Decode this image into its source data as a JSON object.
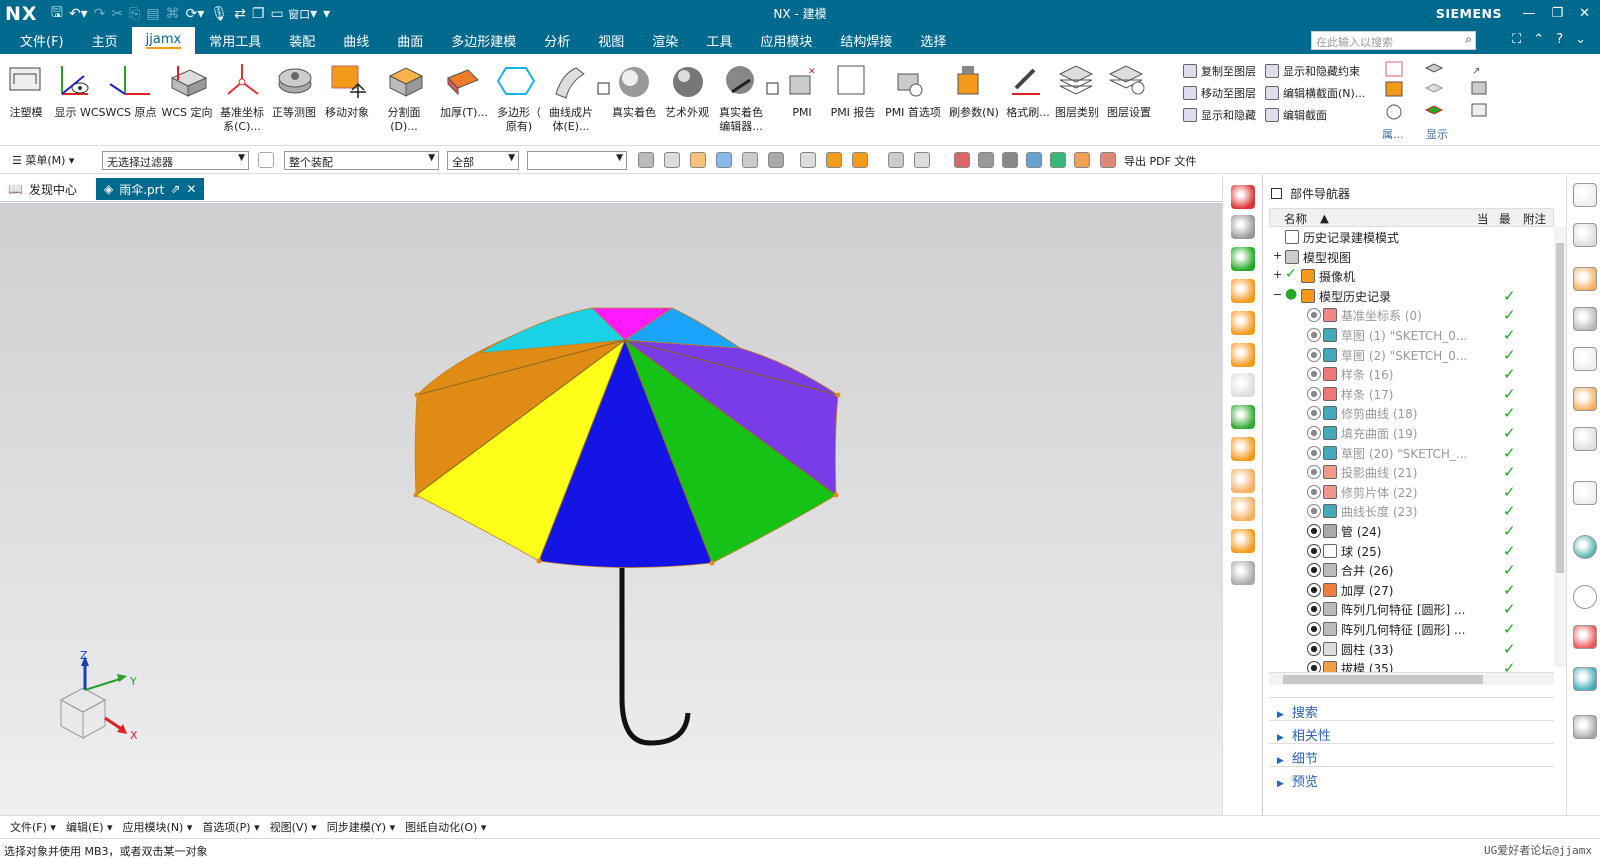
{
  "titlebar": {
    "logo": "NX",
    "title": "NX - 建模",
    "brand": "SIEMENS",
    "window_menu": "窗口"
  },
  "menubar": {
    "items": [
      "文件(F)",
      "主页",
      "jjamx",
      "常用工具",
      "装配",
      "曲线",
      "曲面",
      "多边形建模",
      "分析",
      "视图",
      "渲染",
      "工具",
      "应用模块",
      "结构焊接",
      "选择"
    ],
    "active": "jjamx",
    "search_placeholder": "在此输入以搜索"
  },
  "ribbon": {
    "buttons": [
      "注塑模",
      "显示 WCS",
      "WCS 原点",
      "WCS 定向",
      "基准坐标\n系(C)...",
      "正等测图",
      "移动对象",
      "分割面(D)...",
      "加厚(T)...",
      "多边形（\n原有)",
      "曲线成片\n体(E)...",
      "真实着色",
      "艺术外观",
      "真实着色\n编辑器...",
      "PMI",
      "PMI 报告",
      "PMI 首选项",
      "刷参数(N)",
      "格式刷...",
      "图层类别",
      "图层设置"
    ],
    "small_col1": [
      "复制至图层",
      "移动至图层",
      "显示和隐藏"
    ],
    "small_col2": [
      "显示和隐藏约束",
      "编辑横截面(N)...",
      "编辑截面"
    ],
    "group_labels": [
      "属...",
      "显示"
    ]
  },
  "toolbar2": {
    "menu_label": "菜单(M)",
    "filter_value": "无选择过滤器",
    "assembly_value": "整个装配",
    "scope_value": "全部",
    "extra_value": "",
    "export_label": "导出 PDF 文件"
  },
  "tabs": [
    {
      "label": "发现中心",
      "active": false
    },
    {
      "label": "雨伞.prt",
      "active": true
    }
  ],
  "viewport": {
    "triad": {
      "x": "X",
      "y": "Y",
      "z": "Z"
    },
    "umbrella_colors": [
      "#e08c14",
      "#ffff1a",
      "#1414e6",
      "#17c217",
      "#7a3ce6",
      "#1aa3ff",
      "#ff1aff",
      "#1ad2e6"
    ]
  },
  "navigator": {
    "title": "部件导航器",
    "columns": [
      "名称",
      "当",
      "最",
      "附注"
    ],
    "rows": [
      {
        "label": "历史记录建模模式",
        "level": 1,
        "type": "clock",
        "visible": null,
        "check": false,
        "gray": false
      },
      {
        "label": "模型视图",
        "level": 1,
        "type": "view",
        "visible": null,
        "check": false,
        "gray": false,
        "expander": "+"
      },
      {
        "label": "摄像机",
        "level": 1,
        "type": "camera",
        "visible": null,
        "check": false,
        "gray": false,
        "expander": "+"
      },
      {
        "label": "模型历史记录",
        "level": 1,
        "type": "history",
        "visible": null,
        "check": true,
        "gray": false,
        "expander": "−"
      },
      {
        "label": "基准坐标系 (0)",
        "level": 2,
        "type": "csys",
        "visible": false,
        "check": true,
        "gray": true
      },
      {
        "label": "草图 (1) \"SKETCH_0...",
        "level": 2,
        "type": "sketch",
        "visible": false,
        "check": true,
        "gray": true
      },
      {
        "label": "草图 (2) \"SKETCH_0...",
        "level": 2,
        "type": "sketch",
        "visible": false,
        "check": true,
        "gray": true
      },
      {
        "label": "样条 (16)",
        "level": 2,
        "type": "spline",
        "visible": false,
        "check": true,
        "gray": true
      },
      {
        "label": "样条 (17)",
        "level": 2,
        "type": "spline",
        "visible": false,
        "check": true,
        "gray": true
      },
      {
        "label": "修剪曲线 (18)",
        "level": 2,
        "type": "trim",
        "visible": false,
        "check": true,
        "gray": true
      },
      {
        "label": "填充曲面 (19)",
        "level": 2,
        "type": "surface",
        "visible": false,
        "check": true,
        "gray": true
      },
      {
        "label": "草图 (20) \"SKETCH_...",
        "level": 2,
        "type": "sketch",
        "visible": false,
        "check": true,
        "gray": true
      },
      {
        "label": "投影曲线 (21)",
        "level": 2,
        "type": "project",
        "visible": false,
        "check": true,
        "gray": true
      },
      {
        "label": "修剪片体 (22)",
        "level": 2,
        "type": "trimsheet",
        "visible": false,
        "check": true,
        "gray": true
      },
      {
        "label": "曲线长度 (23)",
        "level": 2,
        "type": "curvelen",
        "visible": false,
        "check": true,
        "gray": true
      },
      {
        "label": "管 (24)",
        "level": 2,
        "type": "tube",
        "visible": true,
        "check": true,
        "gray": false
      },
      {
        "label": "球 (25)",
        "level": 2,
        "type": "sphere",
        "visible": true,
        "check": true,
        "gray": false
      },
      {
        "label": "合并 (26)",
        "level": 2,
        "type": "unite",
        "visible": true,
        "check": true,
        "gray": false
      },
      {
        "label": "加厚 (27)",
        "level": 2,
        "type": "thicken",
        "visible": true,
        "check": true,
        "gray": false
      },
      {
        "label": "阵列几何特征 [圆形] ...",
        "level": 2,
        "type": "pattern",
        "visible": true,
        "check": true,
        "gray": false
      },
      {
        "label": "阵列几何特征 [圆形] ...",
        "level": 2,
        "type": "pattern",
        "visible": true,
        "check": true,
        "gray": false
      },
      {
        "label": "圆柱 (33)",
        "level": 2,
        "type": "cylinder",
        "visible": true,
        "check": true,
        "gray": false
      },
      {
        "label": "拔模 (35)",
        "level": 2,
        "type": "draft",
        "visible": true,
        "check": true,
        "gray": false
      }
    ],
    "sections": [
      "搜索",
      "相关性",
      "细节",
      "预览"
    ]
  },
  "bottombar": {
    "items": [
      "文件(F)",
      "编辑(E)",
      "应用模块(N)",
      "首选项(P)",
      "视图(V)",
      "同步建模(Y)",
      "图纸自动化(O)"
    ]
  },
  "status": {
    "message": "选择对象并使用 MB3，或者双击某一对象",
    "watermark": "UG爱好者论坛@jjamx"
  }
}
